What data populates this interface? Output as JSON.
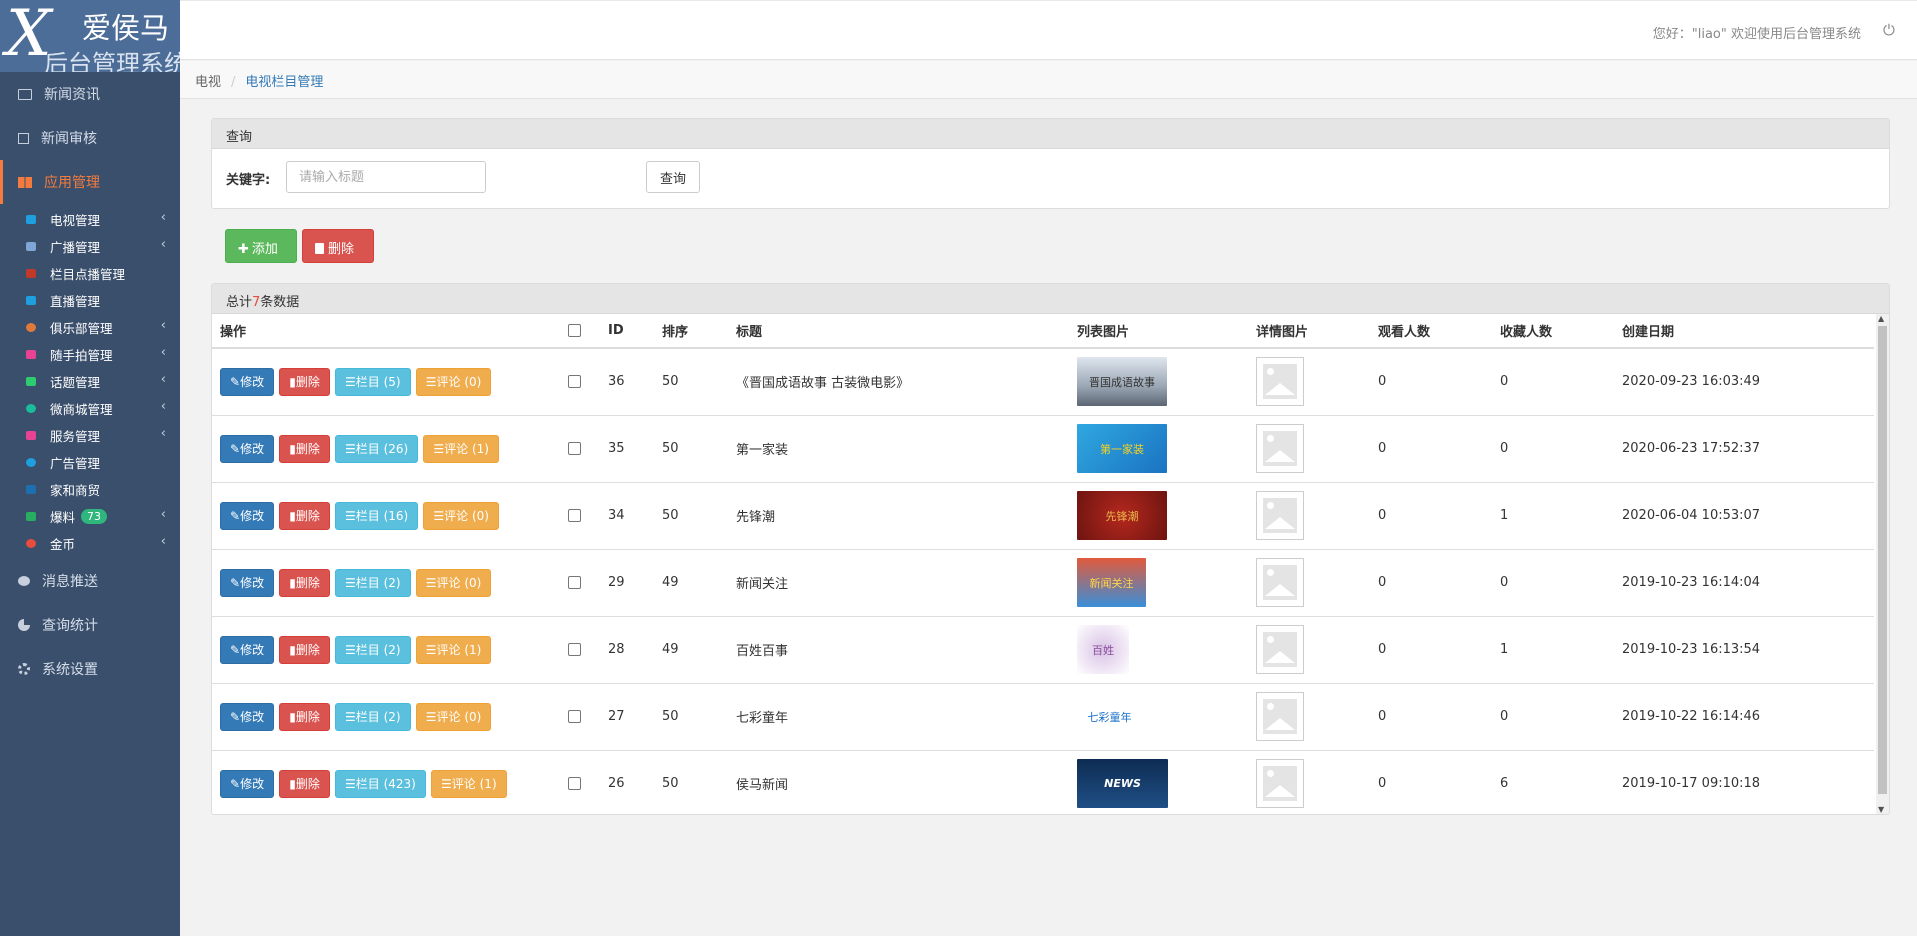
{
  "logo": {
    "mark": "X",
    "line1": "爱侯马",
    "line2": "后台管理系统"
  },
  "sidebar": {
    "top_items": [
      {
        "label": "新闻资讯",
        "icon": "newspaper-icon"
      },
      {
        "label": "新闻审核",
        "icon": "checkbox-icon"
      },
      {
        "label": "应用管理",
        "icon": "grid-icon",
        "active": true
      }
    ],
    "sub_items": [
      {
        "label": "电视管理",
        "color": "#1e9fe0",
        "chevron": true
      },
      {
        "label": "广播管理",
        "color": "#7fa6d6",
        "chevron": true
      },
      {
        "label": "栏目点播管理",
        "color": "#c0392b",
        "chevron": false
      },
      {
        "label": "直播管理",
        "color": "#1e9fe0",
        "chevron": false
      },
      {
        "label": "俱乐部管理",
        "color": "#e07a3a",
        "chevron": true
      },
      {
        "label": "随手拍管理",
        "color": "#e84393",
        "chevron": true
      },
      {
        "label": "话题管理",
        "color": "#2ecc71",
        "chevron": true
      },
      {
        "label": "微商城管理",
        "color": "#1abc9c",
        "chevron": true
      },
      {
        "label": "服务管理",
        "color": "#e84393",
        "chevron": true
      },
      {
        "label": "广告管理",
        "color": "#1e9fe0",
        "chevron": false
      },
      {
        "label": "家和商贸",
        "color": "#1e6fb0",
        "chevron": false
      },
      {
        "label": "爆料",
        "color": "#27ae60",
        "chevron": true,
        "badge": "73"
      },
      {
        "label": "金币",
        "color": "#e74c3c",
        "chevron": true
      }
    ],
    "bottom_items": [
      {
        "label": "消息推送",
        "icon": "chat-icon"
      },
      {
        "label": "查询统计",
        "icon": "pie-chart-icon"
      },
      {
        "label": "系统设置",
        "icon": "gear-icon"
      }
    ]
  },
  "header": {
    "greeting": "您好：\"liao\" 欢迎使用后台管理系统",
    "power_glyph": "⏻"
  },
  "breadcrumb": {
    "root": "电视",
    "current": "电视栏目管理"
  },
  "query": {
    "title": "查询",
    "label": "关键字:",
    "placeholder": "请输入标题",
    "button": "查询"
  },
  "actions": {
    "add": "添加",
    "delete": "删除"
  },
  "table": {
    "summary_prefix": "总计",
    "summary_count": "7",
    "summary_suffix": "条数据",
    "columns": [
      "操作",
      "ID",
      "排序",
      "标题",
      "列表图片",
      "详情图片",
      "观看人数",
      "收藏人数",
      "创建日期"
    ],
    "row_labels": {
      "edit": "修改",
      "delete": "删除",
      "column": "栏目",
      "comment": "评论"
    },
    "rows": [
      {
        "id": "36",
        "sort": "50",
        "title": "《晋国成语故事 古装微电影》",
        "column_count": "(5)",
        "comment_count": "(0)",
        "views": "0",
        "favs": "0",
        "date": "2020-09-23 16:03:49",
        "thumb_text": "晋国成语故事"
      },
      {
        "id": "35",
        "sort": "50",
        "title": "第一家装",
        "column_count": "(26)",
        "comment_count": "(1)",
        "views": "0",
        "favs": "0",
        "date": "2020-06-23 17:52:37",
        "thumb_text": "第一家装"
      },
      {
        "id": "34",
        "sort": "50",
        "title": "先锋潮",
        "column_count": "(16)",
        "comment_count": "(0)",
        "views": "0",
        "favs": "1",
        "date": "2020-06-04 10:53:07",
        "thumb_text": "先锋潮"
      },
      {
        "id": "29",
        "sort": "49",
        "title": "新闻关注",
        "column_count": "(2)",
        "comment_count": "(0)",
        "views": "0",
        "favs": "0",
        "date": "2019-10-23 16:14:04",
        "thumb_text": "新闻关注"
      },
      {
        "id": "28",
        "sort": "49",
        "title": "百姓百事",
        "column_count": "(2)",
        "comment_count": "(1)",
        "views": "0",
        "favs": "1",
        "date": "2019-10-23 16:13:54",
        "thumb_text": "百姓"
      },
      {
        "id": "27",
        "sort": "50",
        "title": "七彩童年",
        "column_count": "(2)",
        "comment_count": "(0)",
        "views": "0",
        "favs": "0",
        "date": "2019-10-22 16:14:46",
        "thumb_text": "七彩童年"
      },
      {
        "id": "26",
        "sort": "50",
        "title": "侯马新闻",
        "column_count": "(423)",
        "comment_count": "(1)",
        "views": "0",
        "favs": "6",
        "date": "2019-10-17 09:10:18",
        "thumb_text": "NEWS"
      }
    ]
  }
}
